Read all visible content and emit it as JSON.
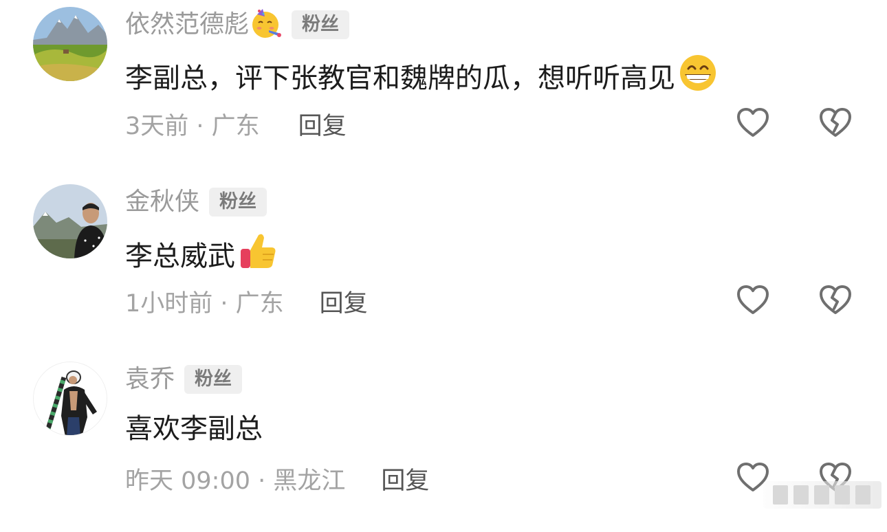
{
  "comments": [
    {
      "username": "依然范德彪",
      "badge": "粉丝",
      "name_emoji": "party-face-emoji",
      "text": "李副总，评下张教官和魏牌的瓜，想听听高见",
      "text_emoji": "grinning-emoji",
      "meta": "3天前 · 广东",
      "reply_label": "回复",
      "avatar": "landscape-mountain-avatar"
    },
    {
      "username": "金秋侠",
      "badge": "粉丝",
      "text": "李总威武",
      "text_emoji": "thumbs-up-emoji",
      "meta": "1小时前 · 广东",
      "reply_label": "回复",
      "avatar": "man-photo-avatar"
    },
    {
      "username": "袁乔",
      "badge": "粉丝",
      "text": "喜欢李副总",
      "meta": "昨天 09:00 · 黑龙江",
      "reply_label": "回复",
      "avatar": "anime-character-avatar"
    }
  ],
  "icons": {
    "like": "heart-icon",
    "dislike": "broken-heart-icon"
  },
  "colors": {
    "username": "#9a9a9a",
    "content": "#1c1c1c",
    "meta": "#a3a3a3",
    "reply": "#555555",
    "badge_bg": "#efefef",
    "icon_stroke": "#6f6f6f"
  }
}
